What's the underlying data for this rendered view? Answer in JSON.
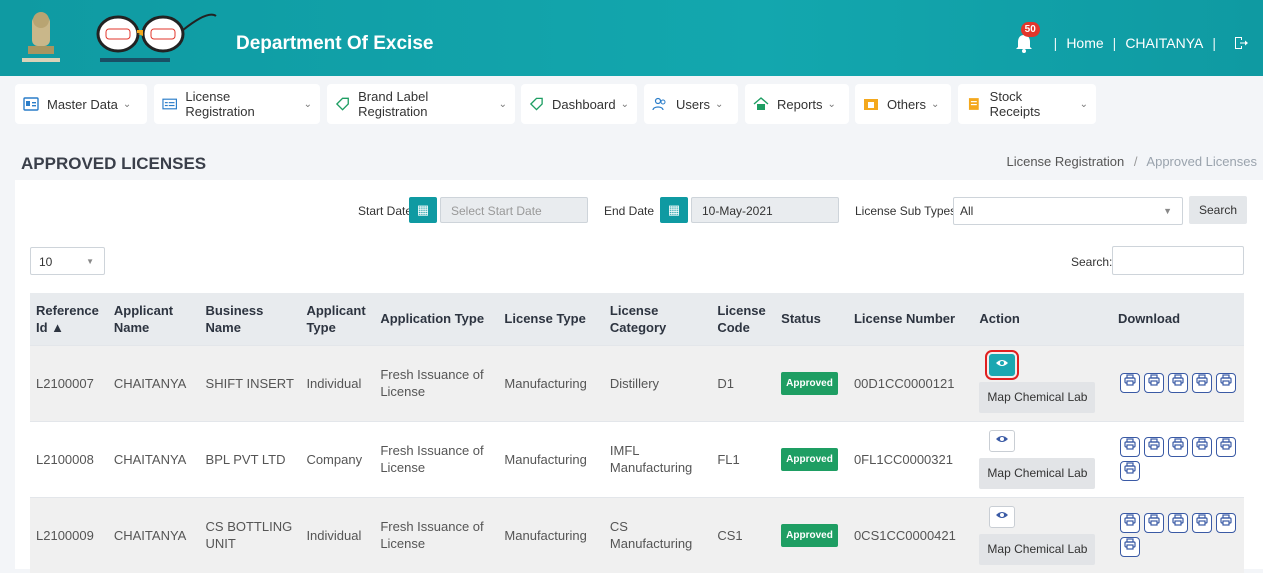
{
  "header": {
    "title": "Department Of Excise",
    "notification_count": "50",
    "home_label": "Home",
    "user_name": "CHAITANYA",
    "divider": "|"
  },
  "nav": [
    {
      "label": "Master Data",
      "icon": "id-card-icon"
    },
    {
      "label": "License Registration",
      "icon": "list-icon"
    },
    {
      "label": "Brand Label Registration",
      "icon": "tag-icon"
    },
    {
      "label": "Dashboard",
      "icon": "tag-icon"
    },
    {
      "label": "Users",
      "icon": "users-icon"
    },
    {
      "label": "Reports",
      "icon": "home-report-icon"
    },
    {
      "label": "Others",
      "icon": "folder-icon"
    },
    {
      "label": "Stock Receipts",
      "icon": "receipt-icon"
    }
  ],
  "page": {
    "title": "APPROVED LICENSES",
    "breadcrumb_parent": "License Registration",
    "breadcrumb_sep": "/",
    "breadcrumb_current": "Approved Licenses"
  },
  "filters": {
    "start_label": "Start Date",
    "start_placeholder": "Select Start Date",
    "end_label": "End Date",
    "end_value": "10-May-2021",
    "subtype_label": "License Sub Types",
    "subtype_value": "All",
    "search_button": "Search"
  },
  "table_controls": {
    "page_length": "10",
    "search_label": "Search:"
  },
  "table": {
    "headers": [
      {
        "line1": "Reference",
        "line2": "Id ▲"
      },
      {
        "line1": "Applicant",
        "line2": "Name"
      },
      {
        "line1": "Business",
        "line2": "Name"
      },
      {
        "line1": "Applicant",
        "line2": "Type"
      },
      {
        "line1": "Application Type",
        "line2": ""
      },
      {
        "line1": "License Type",
        "line2": ""
      },
      {
        "line1": "License",
        "line2": "Category"
      },
      {
        "line1": "License",
        "line2": "Code"
      },
      {
        "line1": "Status",
        "line2": ""
      },
      {
        "line1": "License Number",
        "line2": ""
      },
      {
        "line1": "Action",
        "line2": ""
      },
      {
        "line1": "Download",
        "line2": ""
      }
    ],
    "rows": [
      {
        "ref": "L2100007",
        "applicant": "CHAITANYA",
        "business": "SHIFT INSERT",
        "type": "Individual",
        "app_type": "Fresh Issuance of License",
        "license_type": "Manufacturing",
        "category": "Distillery",
        "code": "D1",
        "status": "Approved",
        "number": "00D1CC0000121",
        "map_label": "Map Chemical Lab",
        "downloads": 5
      },
      {
        "ref": "L2100008",
        "applicant": "CHAITANYA",
        "business": "BPL PVT LTD",
        "type": "Company",
        "app_type": "Fresh Issuance of License",
        "license_type": "Manufacturing",
        "category": "IMFL Manufacturing",
        "code": "FL1",
        "status": "Approved",
        "number": "0FL1CC0000321",
        "map_label": "Map Chemical Lab",
        "downloads": 6
      },
      {
        "ref": "L2100009",
        "applicant": "CHAITANYA",
        "business": "CS BOTTLING UNIT",
        "type": "Individual",
        "app_type": "Fresh Issuance of License",
        "license_type": "Manufacturing",
        "category": "CS Manufacturing",
        "code": "CS1",
        "status": "Approved",
        "number": "0CS1CC0000421",
        "map_label": "Map Chemical Lab",
        "downloads": 6
      }
    ]
  },
  "colors": {
    "header_teal": "#13a7ae",
    "status_green": "#1e9e63",
    "highlight_red": "#e02020"
  }
}
